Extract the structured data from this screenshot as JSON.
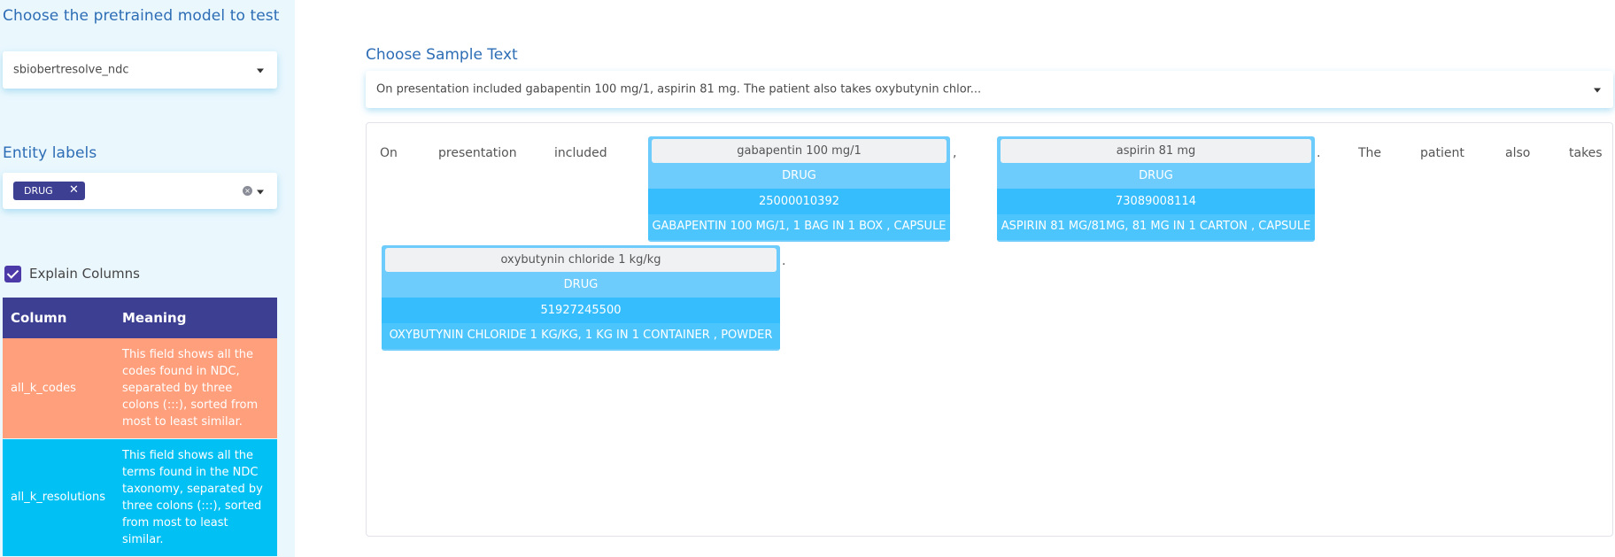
{
  "sidebar": {
    "model_title": "Choose the pretrained model to test",
    "model_select_value": "sbiobertresolve_ndc",
    "entity_title": "Entity labels",
    "entity_tags": [
      "DRUG"
    ],
    "tag_remove_glyph": "✕",
    "clear_glyph": "×",
    "explain_checkbox_label": "Explain Columns",
    "explain_checked": true,
    "table": {
      "headers": [
        "Column",
        "Meaning"
      ],
      "rows": [
        {
          "column": "all_k_codes",
          "meaning": "This field shows all the codes found in NDC, separated by three colons (:::), sorted from most to least similar.",
          "color": "#ff9f7c"
        },
        {
          "column": "all_k_resolutions",
          "meaning": "This field shows all the terms found in the NDC taxonomy, separated by three colons (:::), sorted from most to least similar.",
          "color": "#00c0f4"
        }
      ]
    }
  },
  "main": {
    "sample_title": "Choose Sample Text",
    "sample_select_value": "On presentation included gabapentin 100 mg/1, aspirin 81 mg. The patient also takes oxybutynin chlor...",
    "line1_words": [
      "On",
      "presentation",
      "included"
    ],
    "punct": [
      ",",
      ".",
      "."
    ],
    "line1_tail_words": [
      "The",
      "patient",
      "also",
      "takes"
    ],
    "entities": [
      {
        "text": "gabapentin 100 mg/1",
        "label": "DRUG",
        "code": "25000010392",
        "resolution": "GABAPENTIN 100 MG/1, 1 BAG IN 1 BOX , CAPSULE"
      },
      {
        "text": "aspirin 81 mg",
        "label": "DRUG",
        "code": "73089008114",
        "resolution": "ASPIRIN 81 MG/81MG, 81 MG IN 1 CARTON , CAPSULE"
      },
      {
        "text": "oxybutynin chloride 1 kg/kg",
        "label": "DRUG",
        "code": "51927245500",
        "resolution": "OXYBUTYNIN CHLORIDE 1 KG/KG, 1 KG IN 1 CONTAINER , POWDER"
      }
    ]
  },
  "colors": {
    "accent": "#3d3f92",
    "title": "#2d6db5",
    "chip_label": "#6dccfc",
    "chip_code": "#36bdfd",
    "sidebar_bg": "#eaf7fd"
  }
}
